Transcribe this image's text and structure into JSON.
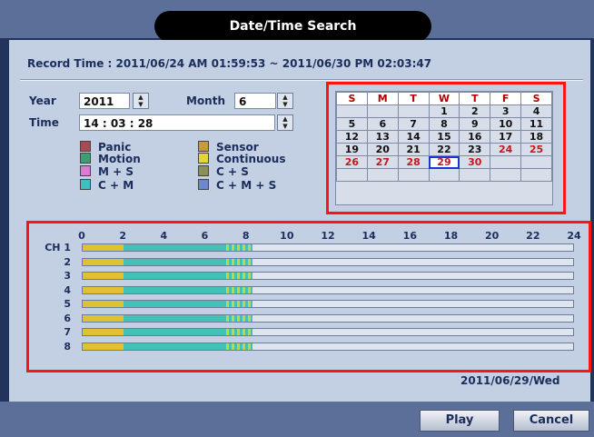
{
  "window": {
    "title": "Date/Time Search"
  },
  "record_time": "Record Time : 2011/06/24 AM 01:59:53 ~ 2011/06/30 PM 02:03:47",
  "year": {
    "label": "Year",
    "value": "2011"
  },
  "month": {
    "label": "Month",
    "value": "6"
  },
  "time": {
    "label": "Time",
    "value": "14 : 03 : 28"
  },
  "legend": [
    {
      "label": "Panic",
      "color": "#a54b55"
    },
    {
      "label": "Sensor",
      "color": "#c89a3f"
    },
    {
      "label": "Motion",
      "color": "#3e9d72"
    },
    {
      "label": "Continuous",
      "color": "#e6d43c"
    },
    {
      "label": "M + S",
      "color": "#d87bd6"
    },
    {
      "label": "C + S",
      "color": "#8a8f55"
    },
    {
      "label": "C + M",
      "color": "#3fc0c0"
    },
    {
      "label": "C + M + S",
      "color": "#6f86c9"
    }
  ],
  "calendar": {
    "headers": [
      "S",
      "M",
      "T",
      "W",
      "T",
      "F",
      "S"
    ],
    "weeks": [
      [
        "",
        "",
        "",
        "1",
        "2",
        "3",
        "4"
      ],
      [
        "5",
        "6",
        "7",
        "8",
        "9",
        "10",
        "11"
      ],
      [
        "12",
        "13",
        "14",
        "15",
        "16",
        "17",
        "18"
      ],
      [
        "19",
        "20",
        "21",
        "22",
        "23",
        "24",
        "25"
      ],
      [
        "26",
        "27",
        "28",
        "29",
        "30",
        "",
        ""
      ],
      [
        "",
        "",
        "",
        "",
        "",
        "",
        ""
      ]
    ],
    "recorded_days": [
      "24",
      "25",
      "26",
      "27",
      "28",
      "29",
      "30"
    ],
    "selected_day": "29"
  },
  "timeline": {
    "hour_ticks": [
      "0",
      "2",
      "4",
      "6",
      "8",
      "10",
      "12",
      "14",
      "16",
      "18",
      "20",
      "22",
      "24"
    ],
    "channels": [
      "CH 1",
      "2",
      "3",
      "4",
      "5",
      "6",
      "7",
      "8"
    ],
    "segments": [
      {
        "start_hour": 0,
        "end_hour": 2.0,
        "type": "Continuous"
      },
      {
        "start_hour": 2.0,
        "end_hour": 7.0,
        "type": "C + M"
      },
      {
        "start_hour": 7.0,
        "end_hour": 8.3,
        "type": "mixed"
      }
    ],
    "colors": {
      "Continuous": "#e0c132",
      "C + M": "#43c1b5",
      "mixed_a": "#b9d94a",
      "mixed_b": "#43c1b5"
    }
  },
  "footer_date": "2011/06/29/Wed",
  "buttons": {
    "play": "Play",
    "cancel": "Cancel"
  }
}
